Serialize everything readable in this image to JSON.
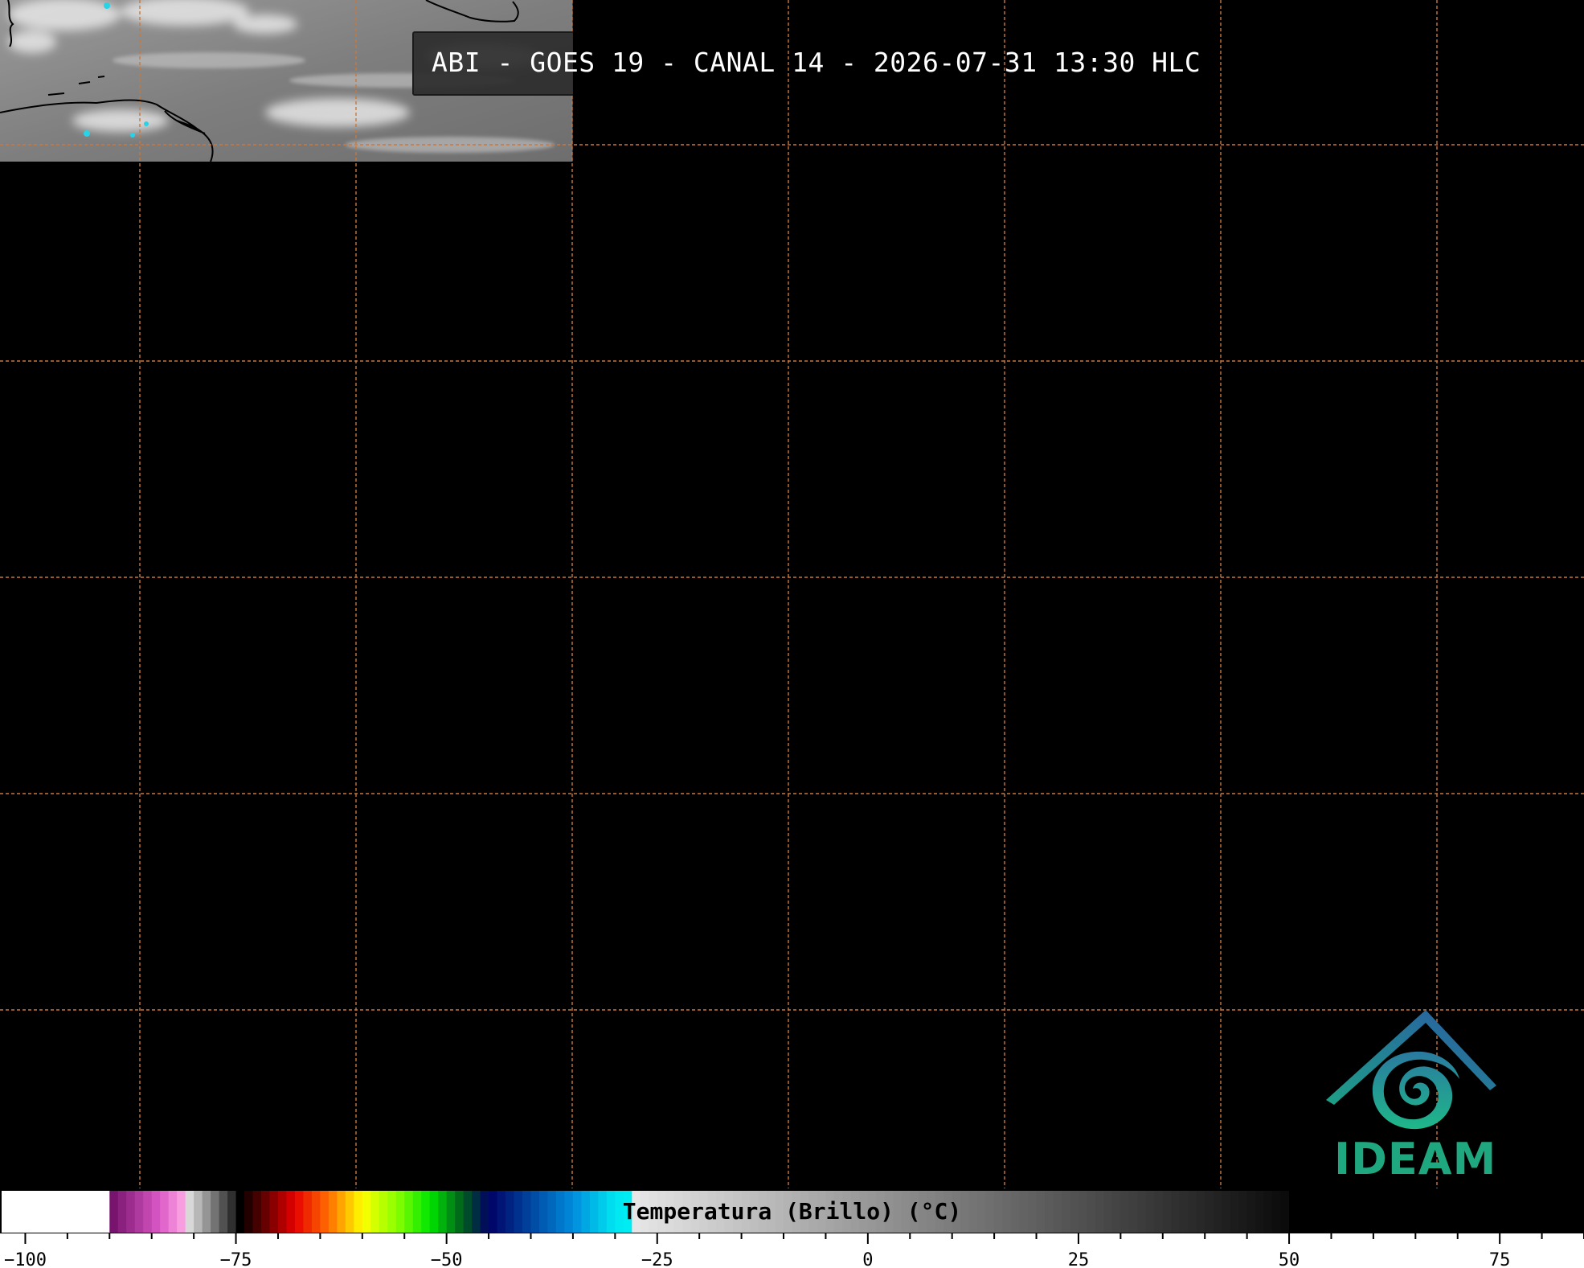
{
  "title": "ABI - GOES 19 - CANAL 14 - 2026-07-31 13:30 HLC",
  "logo": {
    "text": "IDEAM",
    "colors": {
      "roof_start": "#1e9f86",
      "roof_end": "#2a5aa5",
      "swirl": "#1fb889",
      "text": "#1fa87f"
    }
  },
  "colorbar": {
    "label": "Temperatura (Brillo) (°C)",
    "range": [
      -103,
      85
    ],
    "major_ticks": [
      -100,
      -75,
      -50,
      -25,
      0,
      25,
      50,
      75
    ],
    "tick_labels": [
      "−100",
      "−75",
      "−50",
      "−25",
      "0",
      "25",
      "50",
      "75"
    ],
    "minor_step": 5
  },
  "map": {
    "gridline_color": "#c8783c",
    "background": "#000000"
  }
}
